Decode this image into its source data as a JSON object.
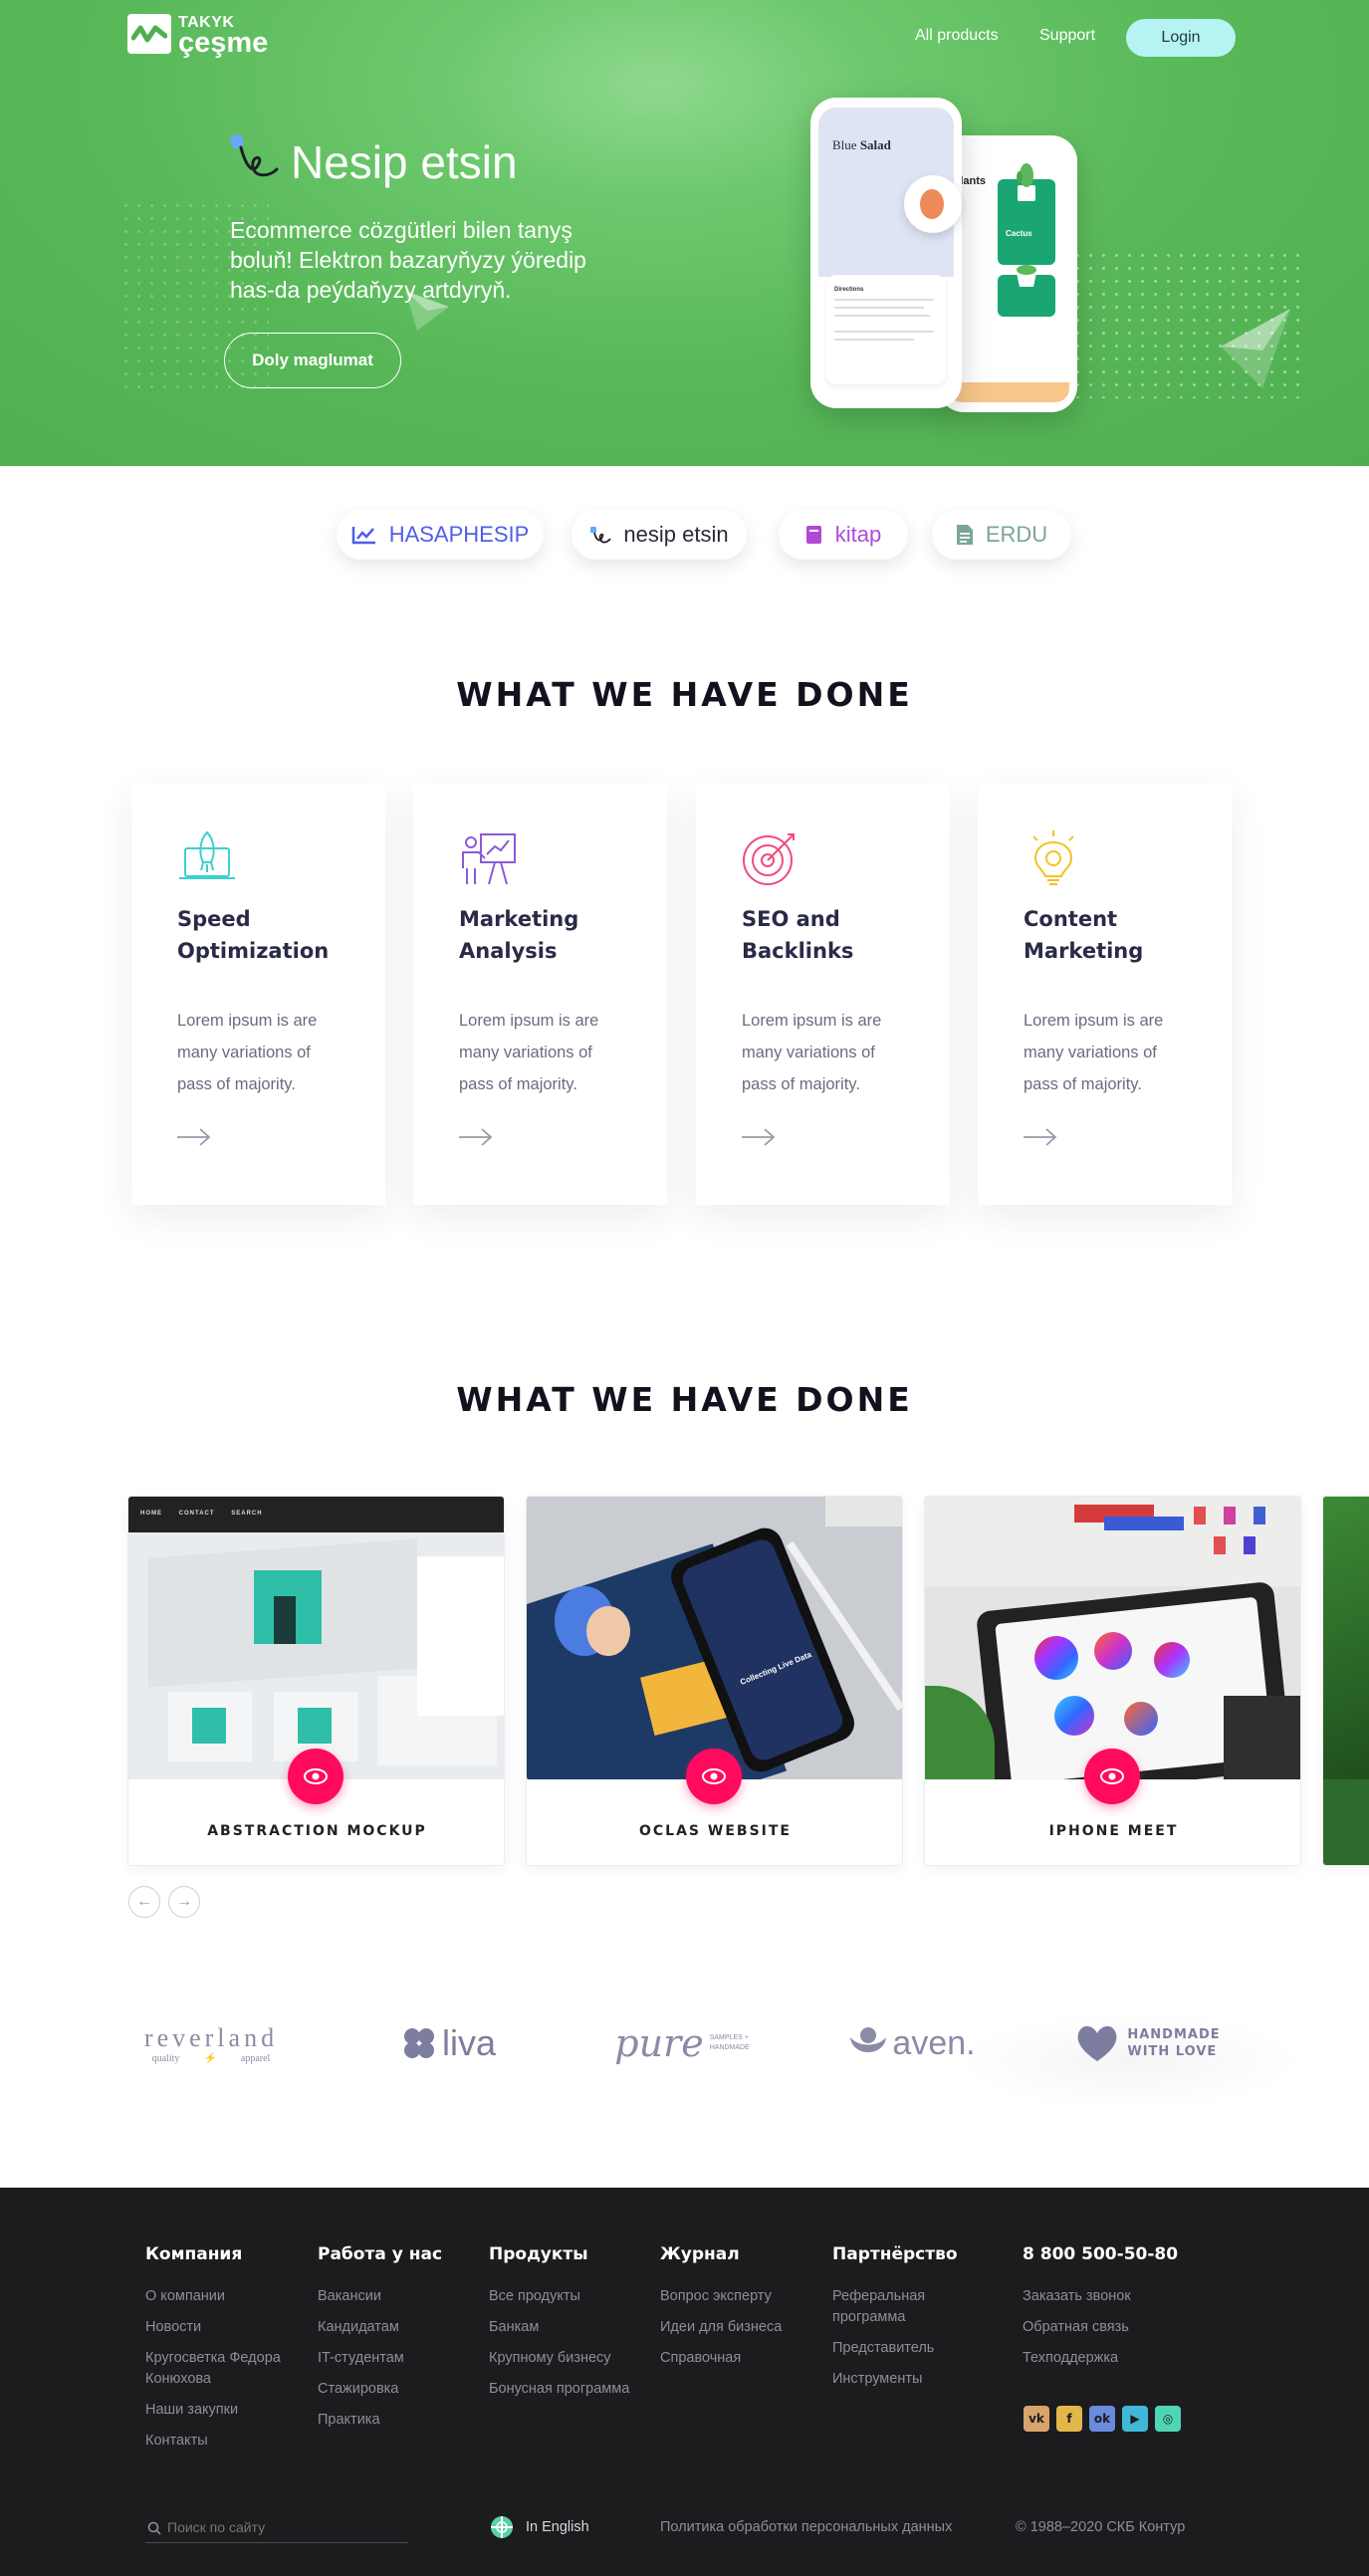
{
  "header": {
    "logo_top": "TAKYK",
    "logo_bottom": "çeşme",
    "nav": [
      "All products",
      "Support"
    ],
    "login_label": "Login"
  },
  "hero": {
    "title": "Nesip etsin",
    "description": "Ecommerce cözgütleri bilen tanyş boluň! Elektron bazaryňyzy ýöredip has-da peýdaňyzy artdyryň.",
    "button_label": "Doly maglumat",
    "phone1": {
      "title_light": "Blue",
      "title_bold": "Salad",
      "section": "Directions"
    },
    "phone2": {
      "title": "Plants",
      "card_title": "Cactus"
    }
  },
  "products": [
    {
      "label": "HASAPHESIP",
      "color": "#4f5ee8",
      "icon": "chart-line-icon"
    },
    {
      "label": "nesip etsin",
      "color": "#2a2a3a",
      "icon": "nesip-logo-icon"
    },
    {
      "label": "kitap",
      "color": "#b04ad6",
      "icon": "book-icon"
    },
    {
      "label": "ERDU",
      "color": "#7aa69a",
      "icon": "document-icon"
    }
  ],
  "services": {
    "heading": "WHAT WE HAVE DONE",
    "items": [
      {
        "title": "Speed Optimization",
        "desc": "Lorem ipsum is are many variations of pass of majority.",
        "icon": "rocket-laptop-icon",
        "color": "#3ecfcf"
      },
      {
        "title": "Marketing Analysis",
        "desc": "Lorem ipsum is are many variations of pass of majority.",
        "icon": "presentation-board-icon",
        "color": "#8a5ad8"
      },
      {
        "title": "SEO and Backlinks",
        "desc": "Lorem ipsum is are many variations of pass of majority.",
        "icon": "target-icon",
        "color": "#ef4c7c"
      },
      {
        "title": "Content Marketing",
        "desc": "Lorem ipsum is are many variations of pass of majority.",
        "icon": "lightbulb-icon",
        "color": "#f3c322"
      }
    ]
  },
  "portfolio": {
    "heading": "WHAT WE HAVE DONE",
    "items": [
      {
        "label": "ABSTRACTION MOCKUP",
        "menu": [
          "HOME",
          "CONTACT",
          "SEARCH"
        ]
      },
      {
        "label": "OCLAS WEBSITE",
        "screen_text": "Collecting Live Data"
      },
      {
        "label": "IPHONE MEET"
      }
    ]
  },
  "brands": [
    {
      "name": "reverland",
      "sub1": "quality",
      "sub2": "apparel"
    },
    {
      "name": "liva"
    },
    {
      "name": "pure",
      "sub1": "SAMPLES + HANDMADE"
    },
    {
      "name": "aven."
    },
    {
      "name": "HANDMADE",
      "sub1": "WITH LOVE"
    }
  ],
  "footer": {
    "columns": [
      {
        "title": "Компания",
        "links": [
          "О компании",
          "Новости",
          "Кругосветка Федора Конюхова",
          "Наши закупки",
          "Контакты"
        ]
      },
      {
        "title": "Работа у нас",
        "links": [
          "Вакансии",
          "Кандидатам",
          "IT-студентам",
          "Стажировка",
          "Практика"
        ]
      },
      {
        "title": "Продукты",
        "links": [
          "Все продукты",
          "Банкам",
          "Крупному бизнесу",
          "Бонусная программа"
        ]
      },
      {
        "title": "Журнал",
        "links": [
          "Вопрос эксперту",
          "Идеи для бизнеса",
          "Справочная"
        ]
      },
      {
        "title": "Партнёрство",
        "links": [
          "Реферальная программа",
          "Представитель",
          "Инструменты"
        ]
      },
      {
        "title": "8 800 500-50-80",
        "links": [
          "Заказать звонок",
          "Обратная связь",
          "Техподдержка"
        ]
      }
    ],
    "social": [
      {
        "icon": "vk-icon",
        "glyph": "vk",
        "color": "#d9a36c"
      },
      {
        "icon": "facebook-icon",
        "glyph": "f",
        "color": "#e2b64a"
      },
      {
        "icon": "odnoklassniki-icon",
        "glyph": "ok",
        "color": "#6a8ae0"
      },
      {
        "icon": "youtube-icon",
        "glyph": "▶",
        "color": "#41b8d8"
      },
      {
        "icon": "instagram-icon",
        "glyph": "◎",
        "color": "#4ed6b4"
      }
    ],
    "search_placeholder": "Поиск по сайту",
    "language": "In English",
    "privacy": "Политика обработки персональных данных",
    "copyright": "© 1988–2020 СКБ Контур"
  }
}
